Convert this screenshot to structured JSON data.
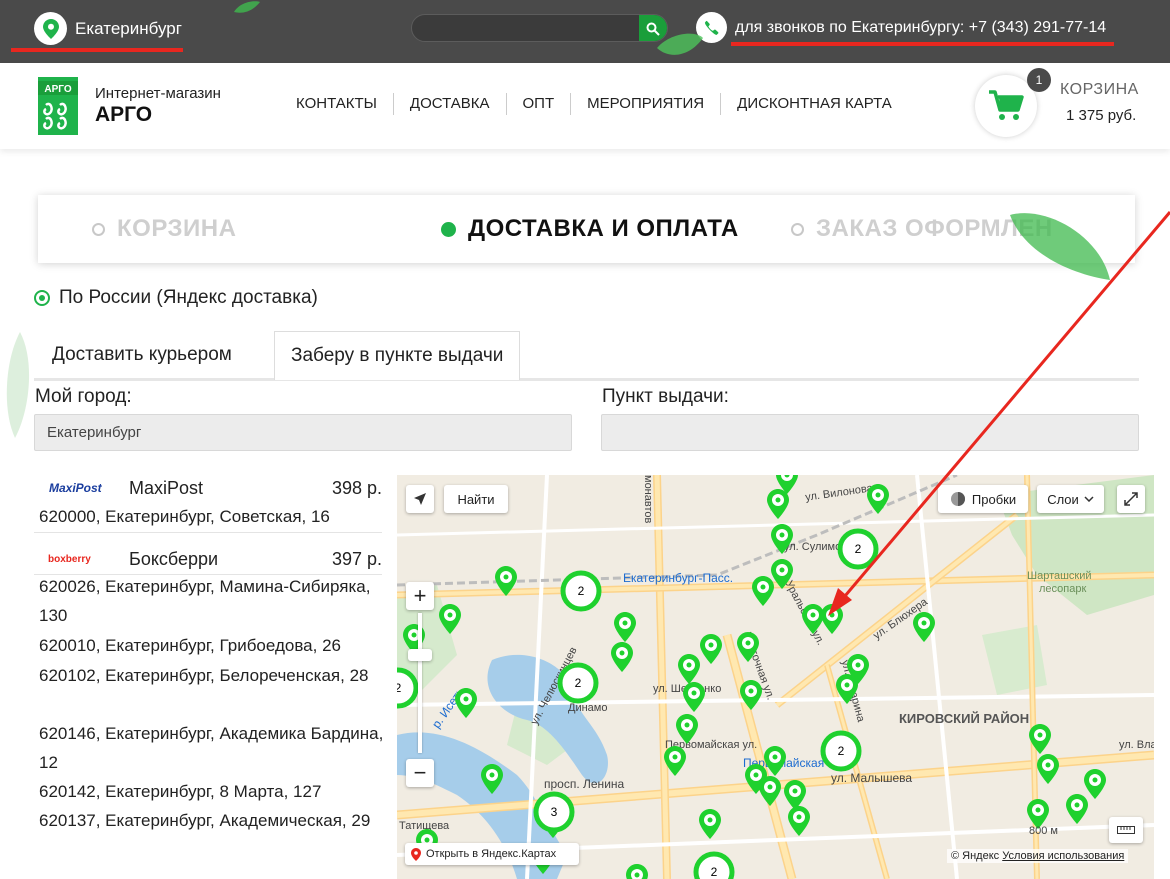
{
  "topbar": {
    "city": "Екатеринбург",
    "search_placeholder": "",
    "phone_text": "для звонков по Екатеринбургу: +7 (343) 291-77-14"
  },
  "header": {
    "logo_text": "АРГО",
    "brand_subtitle": "Интернет-магазин",
    "brand_name": "АРГО",
    "nav": [
      "КОНТАКТЫ",
      "ДОСТАВКА",
      "ОПТ",
      "МЕРОПРИЯТИЯ",
      "ДИСКОНТНАЯ КАРТА"
    ],
    "cart_label": "КОРЗИНА",
    "cart_count": "1",
    "cart_total": "1 375 руб."
  },
  "steps": {
    "step1": "КОРЗИНА",
    "step2": "ДОСТАВКА И ОПЛАТА",
    "step3": "ЗАКАЗ ОФОРМЛЕН"
  },
  "delivery": {
    "option_label": "По России (Яндекс доставка)",
    "tab_courier": "Доставить курьером",
    "tab_pickup": "Заберу в пункте выдачи",
    "city_label": "Мой город:",
    "city_value": "Екатеринбург",
    "pickup_label": "Пункт выдачи:",
    "pickup_value": ""
  },
  "services": [
    {
      "logo": "MaxiPost",
      "name": "MaxiPost",
      "price": "398 р.",
      "addresses": [
        "620000, Екатеринбург, Советская, 16"
      ]
    },
    {
      "logo": "boxberry",
      "name": "Боксберри",
      "price": "397 р.",
      "addresses": [
        "620026, Екатеринбург, Мамина-Сибиряка, 130",
        "620010, Екатеринбург, Грибоедова, 26",
        "620102, Екатеринбург, Белореченская, 28",
        "620146, Екатеринбург, Академика Бардина, 12",
        "620142, Екатеринбург, 8 Марта, 127",
        "620137, Екатеринбург, Академическая, 29"
      ]
    }
  ],
  "map": {
    "find_button": "Найти",
    "traffic_button": "Пробки",
    "layers_button": "Слои",
    "open_link": "Открыть в Яндекс.Картах",
    "copyright": "© Яндекс",
    "terms_link": "Условия использования",
    "scale": "800 м",
    "labels": {
      "monavtov": "монавтов",
      "vilonova": "ул. Вилонова",
      "sulimova": "ул. Сулимо",
      "station": "Екатеринбург-Пасс.",
      "shartash": "Шарташский",
      "lesopark": "лесопарк",
      "blyuhera": "ул. Блюхера",
      "uralskaya": "Уральская ул.",
      "chelyuskintsev": "ул. Челюскинцев",
      "vostochnaya": "Восточная ул.",
      "sheveenko": "ул. Шевченко",
      "dinamo": "Динамо",
      "kirovsky": "КИРОВСКИЙ РАЙОН",
      "gagarina": "ул. Гагарина",
      "pervomayskaya": "Первомайская ул.",
      "metro": "Первомайская",
      "lenina": "просп. Ленина",
      "malysheva": "ул. Малышева",
      "tatishcheva": "Татищева",
      "iset": "р. Исеть",
      "vla": "ул. Вла"
    },
    "cluster_counts": [
      "2",
      "2",
      "2",
      "2",
      "3",
      "2",
      "2"
    ]
  },
  "colors": {
    "accent_green": "#1fb34b",
    "topbar_bg": "#4a4a4a",
    "annotation_red": "#e8271f"
  }
}
